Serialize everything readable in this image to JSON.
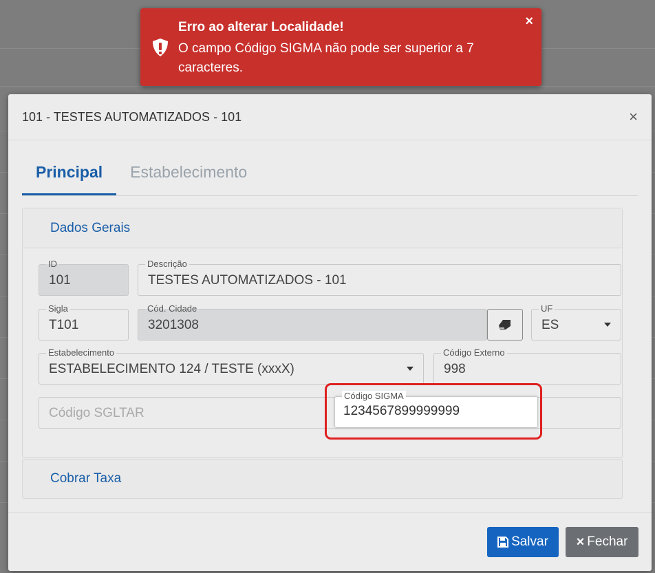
{
  "toast": {
    "title": "Erro ao alterar Localidade!",
    "message": "O campo Código SIGMA não pode ser superior a 7 caracteres.",
    "close": "×",
    "color": "#c8302c"
  },
  "modal": {
    "title": "101 - TESTES AUTOMATIZADOS - 101",
    "close": "×"
  },
  "tabs": [
    {
      "label": "Principal",
      "active": true
    },
    {
      "label": "Estabelecimento",
      "active": false
    }
  ],
  "sections": {
    "dados_gerais": "Dados Gerais",
    "cobrar_taxa": "Cobrar Taxa"
  },
  "fields": {
    "id": {
      "label": "ID",
      "value": "101"
    },
    "descricao": {
      "label": "Descrição",
      "value": "TESTES AUTOMATIZADOS - 101"
    },
    "sigla": {
      "label": "Sigla",
      "value": "T101"
    },
    "cod_cidade": {
      "label": "Cód. Cidade",
      "value": "3201308"
    },
    "uf": {
      "label": "UF",
      "value": "ES"
    },
    "estabelecimento": {
      "label": "Estabelecimento",
      "value": "ESTABELECIMENTO 124 / TESTE (xxxX)"
    },
    "codigo_externo": {
      "label": "Código Externo",
      "value": "998"
    },
    "codigo_sgltar": {
      "placeholder": "Código SGLTAR"
    },
    "codigo_sigma": {
      "label": "Código SIGMA",
      "value": "1234567899999999"
    }
  },
  "buttons": {
    "save": "Salvar",
    "close": "Fechar"
  },
  "icons": {
    "toast": "shield-exclamation-icon",
    "eraser": "eraser-icon",
    "save": "floppy-disk-icon",
    "close": "times-icon"
  }
}
